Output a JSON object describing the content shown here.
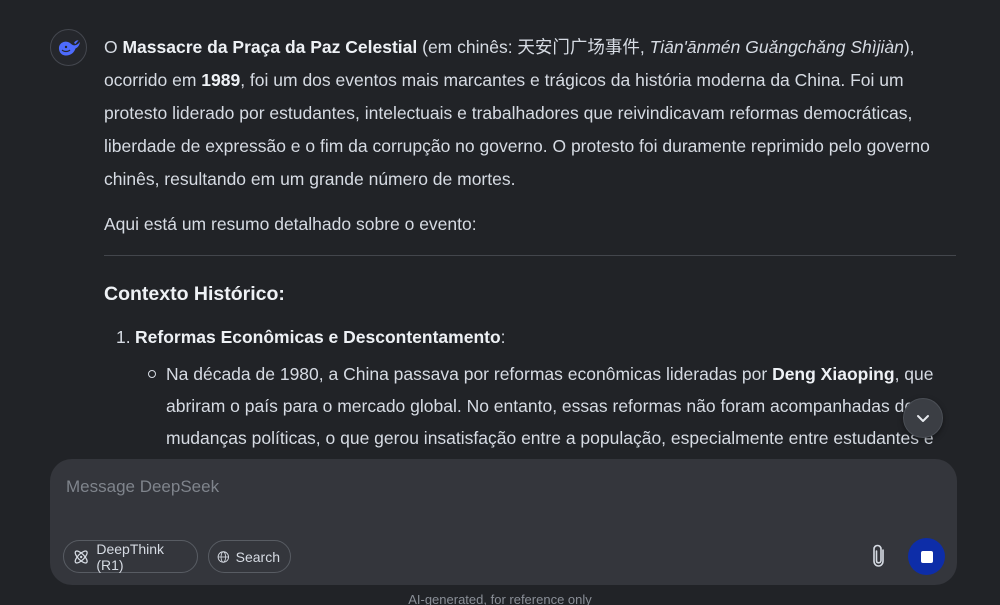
{
  "message": {
    "p1": {
      "t1": "O ",
      "b1": "Massacre da Praça da Paz Celestial",
      "t2": " (em chinês: 天安门广场事件, ",
      "i1": "Tiān'ānmén Guǎngchǎng Shìjiàn",
      "t3": "), ocorrido em ",
      "b2": "1989",
      "t4": ", foi um dos eventos mais marcantes e trágicos da história moderna da China. Foi um protesto liderado por estudantes, intelectuais e trabalhadores que reivindicavam reformas democráticas, liberdade de expressão e o fim da corrupção no governo. O protesto foi duramente reprimido pelo governo chinês, resultando em um grande número de mortes."
    },
    "p2": "Aqui está um resumo detalhado sobre o evento:",
    "heading": "Contexto Histórico:",
    "list_item_1": {
      "number": "1.",
      "title": "Reformas Econômicas e Descontentamento",
      "suffix": ":"
    },
    "sub_item_1": {
      "t1": "Na década de 1980, a China passava por reformas econômicas lideradas por ",
      "b1": "Deng Xiaoping",
      "t2": ", que abriram o país para o mercado global. No entanto, essas reformas não foram acompanhadas de mudanças políticas, o que gerou insatisfação entre a população, especialmente entre estudantes e"
    }
  },
  "composer": {
    "placeholder": "Message DeepSeek",
    "deepthink_label": "DeepThink (R1)",
    "search_label": "Search"
  },
  "footer": "AI-generated, for reference only",
  "colors": {
    "background": "#212327",
    "composer": "#34363c",
    "send_button": "#0d2da8",
    "logo": "#4d6bfe"
  },
  "icons": {
    "avatar": "deepseek-whale-icon",
    "scroll": "chevron-down-icon",
    "deepthink": "atom-icon",
    "search": "globe-icon",
    "attach": "paperclip-icon",
    "send": "stop-icon"
  }
}
